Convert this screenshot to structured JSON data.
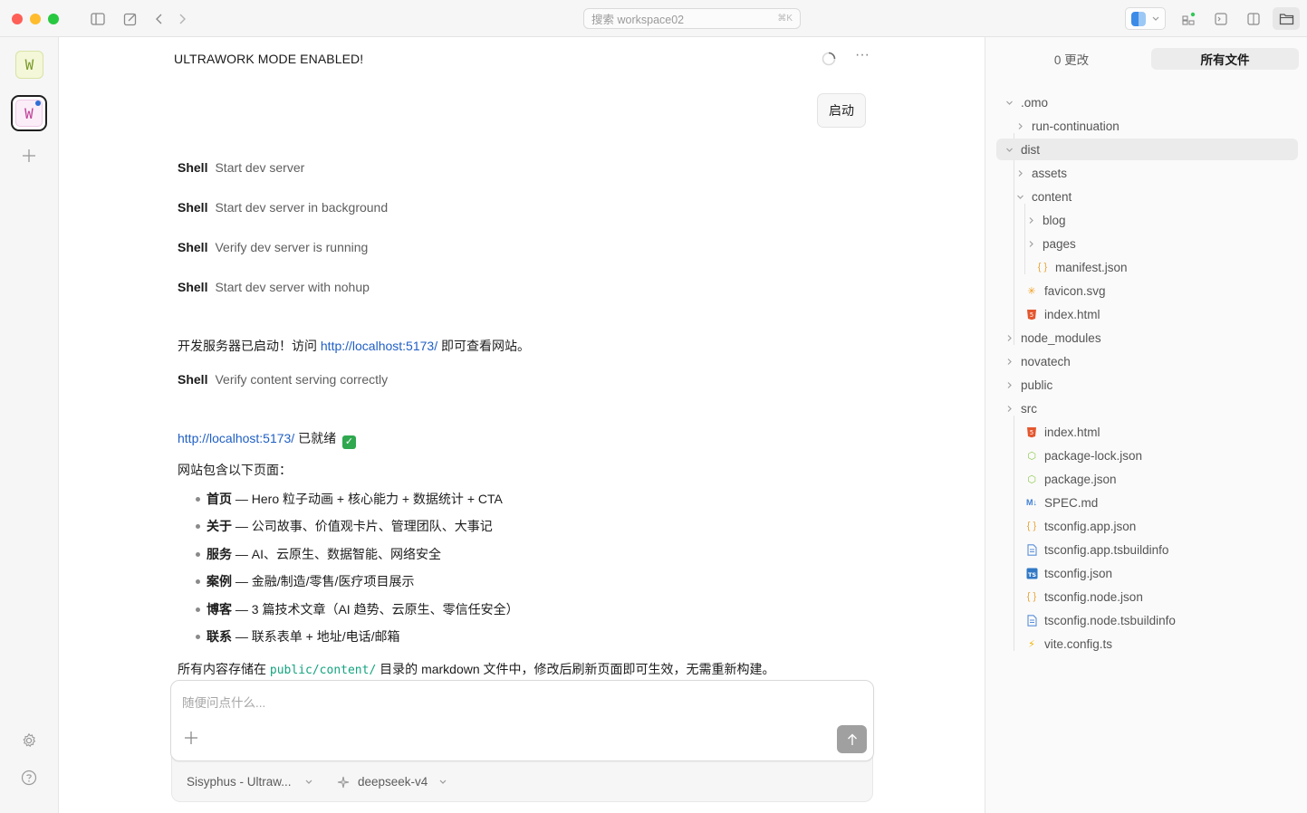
{
  "titlebar": {
    "search_placeholder": "搜索 workspace02",
    "search_shortcut": "⌘K"
  },
  "workspaces": [
    {
      "letter": "W",
      "color": "#7a9a2a"
    },
    {
      "letter": "W",
      "color": "#c0429a",
      "active": true,
      "unread_dot": true
    }
  ],
  "session": {
    "title": "ULTRAWORK MODE ENABLED!",
    "user_message": "启动",
    "shell_label": "Shell",
    "shell_items": [
      "Start dev server",
      "Start dev server in background",
      "Verify dev server is running",
      "Start dev server with nohup"
    ],
    "server_msg_pre": "开发服务器已启动！访问 ",
    "server_url": "http://localhost:5173/",
    "server_msg_post": " 即可查看网站。",
    "shell_verify": "Verify content serving correctly",
    "ready_url": "http://localhost:5173/",
    "ready_text": " 已就绪 ",
    "pages_intro": "网站包含以下页面：",
    "pages": [
      {
        "name": "首页",
        "desc": " — Hero 粒子动画 + 核心能力 + 数据统计 + CTA"
      },
      {
        "name": "关于",
        "desc": " — 公司故事、价值观卡片、管理团队、大事记"
      },
      {
        "name": "服务",
        "desc": " — AI、云原生、数据智能、网络安全"
      },
      {
        "name": "案例",
        "desc": " — 金融/制造/零售/医疗项目展示"
      },
      {
        "name": "博客",
        "desc": " — 3 篇技术文章（AI 趋势、云原生、零信任安全）"
      },
      {
        "name": "联系",
        "desc": " — 联系表单 + 地址/电话/邮箱"
      }
    ],
    "storage_pre": "所有内容存储在 ",
    "storage_path": "public/content/",
    "storage_post": " 目录的 markdown 文件中，修改后刷新页面即可生效，无需重新构建。"
  },
  "composer": {
    "placeholder": "随便问点什么...",
    "agent": "Sisyphus - Ultraw...",
    "model": "deepseek-v4"
  },
  "files_panel": {
    "tab_changes": "0 更改",
    "tab_all": "所有文件",
    "tree": [
      {
        "name": ".omo",
        "depth": 0,
        "kind": "folder",
        "open": true
      },
      {
        "name": "run-continuation",
        "depth": 1,
        "kind": "folder",
        "open": false
      },
      {
        "name": "dist",
        "depth": 0,
        "kind": "folder",
        "open": true,
        "selected": true
      },
      {
        "name": "assets",
        "depth": 1,
        "kind": "folder",
        "open": false
      },
      {
        "name": "content",
        "depth": 1,
        "kind": "folder",
        "open": true
      },
      {
        "name": "blog",
        "depth": 2,
        "kind": "folder",
        "open": false
      },
      {
        "name": "pages",
        "depth": 2,
        "kind": "folder",
        "open": false
      },
      {
        "name": "manifest.json",
        "depth": 2,
        "kind": "json",
        "icon": "{ }",
        "color": "#e8a53a"
      },
      {
        "name": "favicon.svg",
        "depth": 1,
        "kind": "svg",
        "icon": "✳",
        "color": "#f0a020"
      },
      {
        "name": "index.html",
        "depth": 1,
        "kind": "html",
        "icon": "5",
        "color": "#e4572e"
      },
      {
        "name": "node_modules",
        "depth": 0,
        "kind": "folder",
        "open": false
      },
      {
        "name": "novatech",
        "depth": 0,
        "kind": "folder",
        "open": false
      },
      {
        "name": "public",
        "depth": 0,
        "kind": "folder",
        "open": false
      },
      {
        "name": "src",
        "depth": 0,
        "kind": "folder",
        "open": false
      },
      {
        "name": "index.html",
        "depth": 1,
        "kind": "html",
        "icon": "5",
        "color": "#e4572e"
      },
      {
        "name": "package-lock.json",
        "depth": 1,
        "kind": "npm",
        "icon": "⬡",
        "color": "#8cc84b"
      },
      {
        "name": "package.json",
        "depth": 1,
        "kind": "npm",
        "icon": "⬡",
        "color": "#8cc84b"
      },
      {
        "name": "SPEC.md",
        "depth": 1,
        "kind": "md",
        "icon": "M↓",
        "color": "#3f7fd6"
      },
      {
        "name": "tsconfig.app.json",
        "depth": 1,
        "kind": "json",
        "icon": "{ }",
        "color": "#e8a53a"
      },
      {
        "name": "tsconfig.app.tsbuildinfo",
        "depth": 1,
        "kind": "file",
        "icon": "▤",
        "color": "#5b8fd9"
      },
      {
        "name": "tsconfig.json",
        "depth": 1,
        "kind": "ts",
        "icon": "TS",
        "color": "#3178c6"
      },
      {
        "name": "tsconfig.node.json",
        "depth": 1,
        "kind": "json",
        "icon": "{ }",
        "color": "#e8a53a"
      },
      {
        "name": "tsconfig.node.tsbuildinfo",
        "depth": 1,
        "kind": "file",
        "icon": "▤",
        "color": "#5b8fd9"
      },
      {
        "name": "vite.config.ts",
        "depth": 1,
        "kind": "vite",
        "icon": "⚡",
        "color": "#f0b400"
      }
    ]
  },
  "colors": {
    "accent_link": "#1f5fc4",
    "code_path": "#14a37f",
    "success": "#2fa84f"
  }
}
